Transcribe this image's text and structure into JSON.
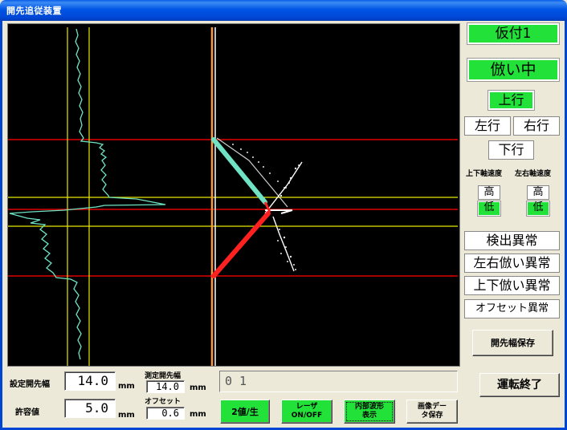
{
  "window": {
    "title": "開先追従装置"
  },
  "status": {
    "mode": "仮付1",
    "tracking": "倣い中",
    "up": "上行",
    "left": "左行",
    "right": "右行",
    "down": "下行",
    "speed_ud_label": "上下軸速度",
    "speed_lr_label": "左右軸速度",
    "ud_high": "高",
    "ud_low": "低",
    "lr_high": "高",
    "lr_low": "低"
  },
  "errors": {
    "detect": "検出異常",
    "lr_follow": "左右倣い異常",
    "ud_follow": "上下倣い異常",
    "offset": "オフセット異常"
  },
  "buttons": {
    "save_groove": "開先幅保存",
    "stop": "運転終了",
    "binary": "2値/生",
    "laser_line1": "レーザ",
    "laser_line2": "ON/OFF",
    "wave_line1": "内部波形",
    "wave_line2": "表示",
    "image_line1": "画像デー",
    "image_line2": "タ保存"
  },
  "fields": {
    "set_groove_label": "設定開先幅",
    "set_groove_value": "14.0",
    "tolerance_label": "許容値",
    "tolerance_value": "5.0",
    "measured_label": "測定開先幅",
    "measured_value": "14.0",
    "offset_label": "オフセット",
    "offset_value": "0.6",
    "unit_mm": "mm",
    "message": "0 1"
  },
  "colors": {
    "indicator_green": "#22E23A",
    "trace_cyan": "#6FE3C4",
    "guide_red": "#E00000",
    "guide_yellow": "#E8E800",
    "laser_red": "#FF2020"
  }
}
